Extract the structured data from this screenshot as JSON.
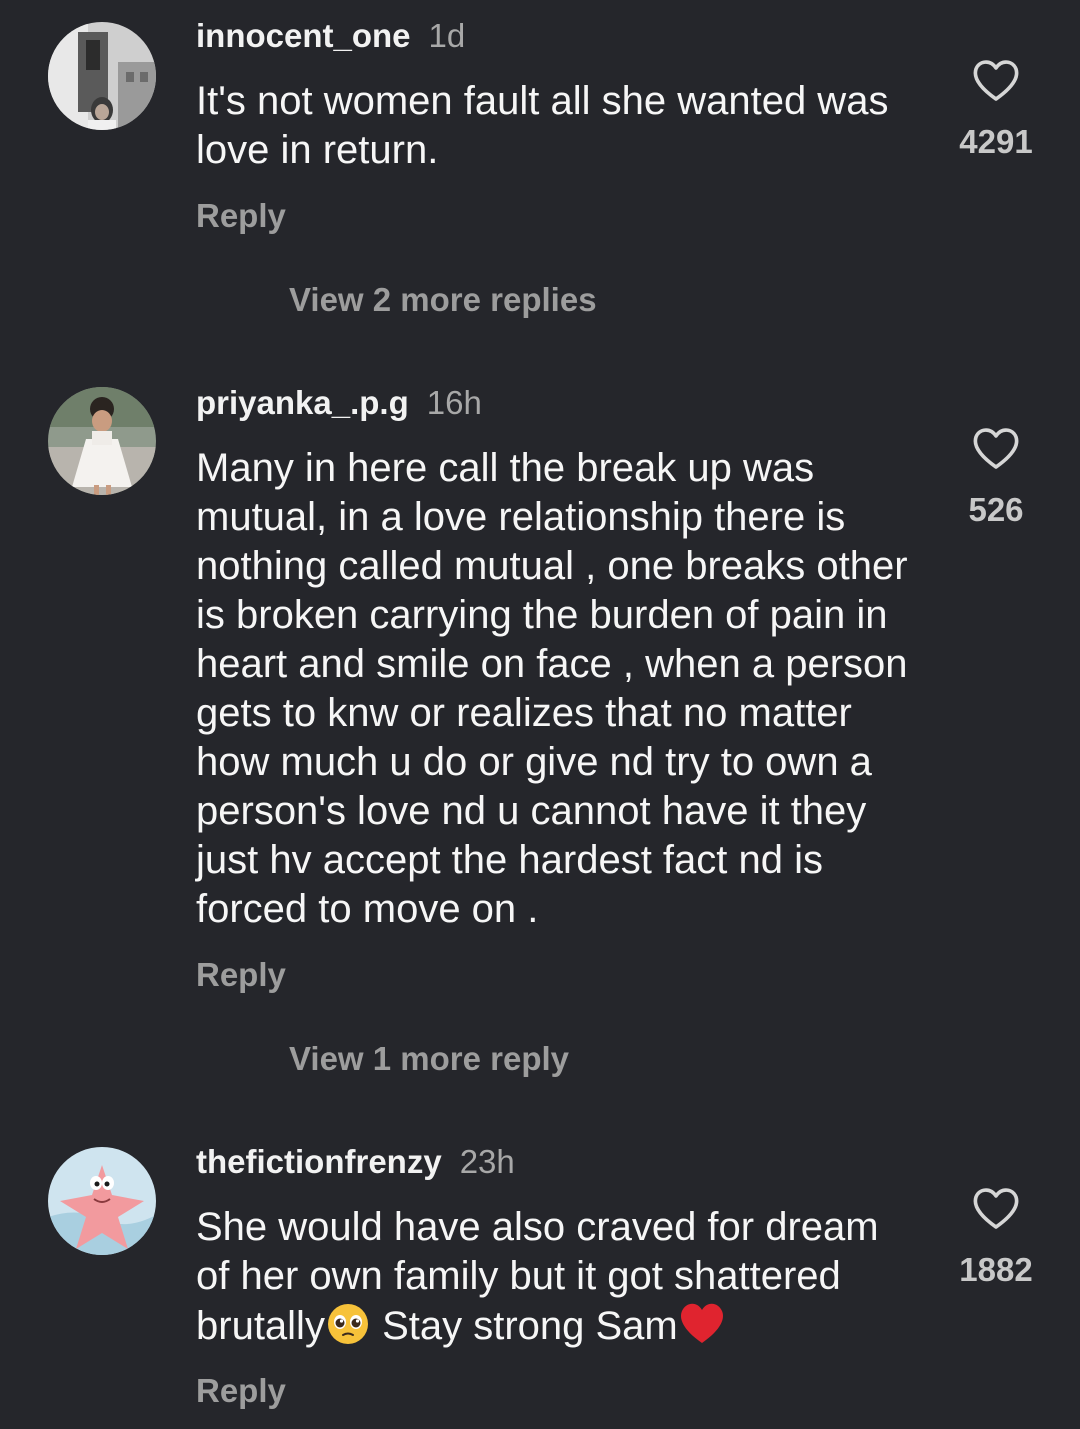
{
  "comments": [
    {
      "username": "innocent_one",
      "time": "1d",
      "text": "It's not women fault all she wanted was love in return.",
      "reply_label": "Reply",
      "view_replies": "View 2 more replies",
      "likes": "4291",
      "avatar_icon": "woman-portrait-avatar"
    },
    {
      "username": "priyanka_.p.g",
      "time": "16h",
      "text": "Many in here call the  break up was mutual, in a love relationship there is nothing called mutual , one breaks other is broken carrying the burden of pain in heart and smile on face , when a person gets to knw or realizes that no matter how much u do or give nd try to own a person's love nd u cannot have it they just hv accept the hardest fact nd is forced to move on .",
      "reply_label": "Reply",
      "view_replies": "View 1 more reply",
      "likes": "526",
      "avatar_icon": "child-in-white-dress-avatar"
    },
    {
      "username": "thefictionfrenzy",
      "time": "23h",
      "text_part1": "She would have also craved for dream of her own family but it got shattered brutally",
      "text_part2": " Stay strong Sam",
      "emoji1": "pleading-face-emoji",
      "emoji2": "red-heart-emoji",
      "reply_label": "Reply",
      "likes": "1882",
      "avatar_icon": "patrick-star-avatar"
    }
  ],
  "colors": {
    "background": "#25262b",
    "text": "#f6f6f6",
    "muted": "#9d9d9d",
    "heart_emoji": "#e0242f",
    "pleading_emoji": "#f7c23a"
  },
  "icons": {
    "like": "heart-outline-icon"
  }
}
